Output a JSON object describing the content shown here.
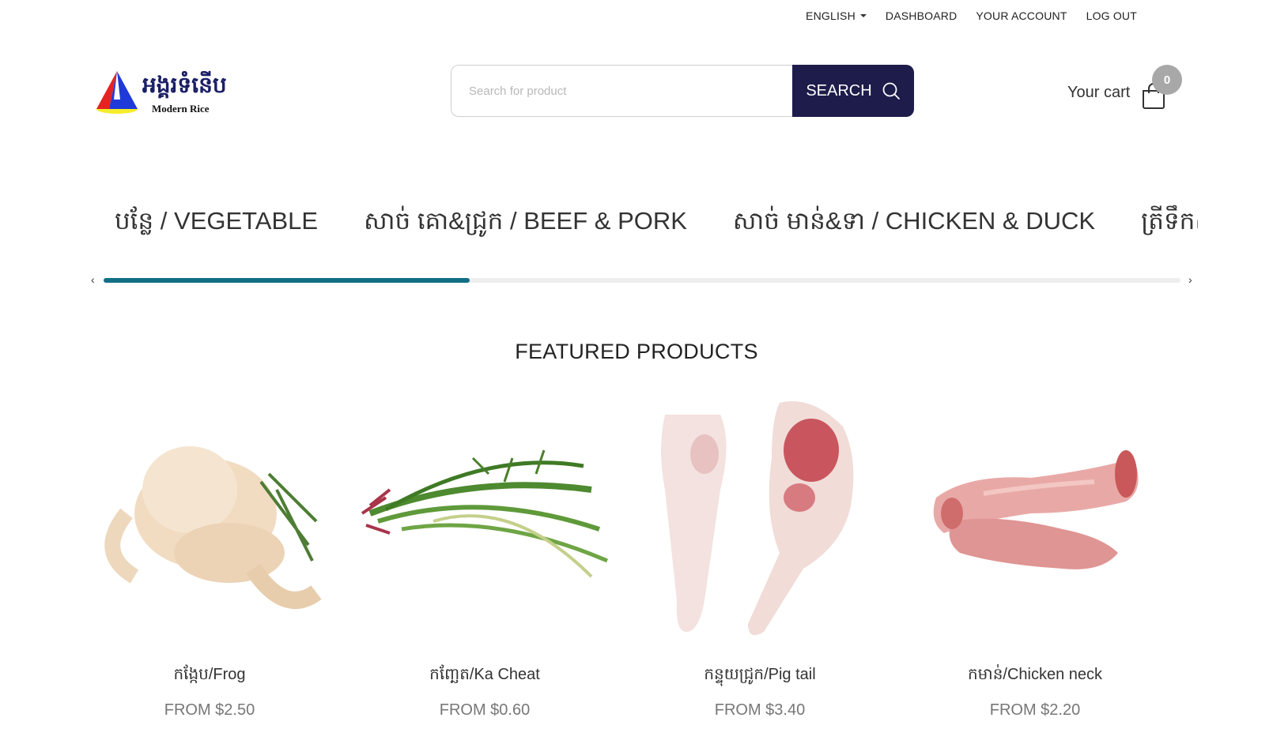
{
  "nav": {
    "language": "ENGLISH",
    "dashboard": "DASHBOARD",
    "account": "YOUR ACCOUNT",
    "logout": "LOG OUT"
  },
  "logo": {
    "khmer": "អង្គរទំនើប",
    "english": "Modern Rice"
  },
  "search": {
    "placeholder": "Search for product",
    "button": "SEARCH",
    "icon": "search-icon"
  },
  "cart": {
    "label": "Your cart",
    "count": "0",
    "icon": "shopping-bag-icon"
  },
  "categories": [
    "បន្លែ / VEGETABLE",
    "សាច់ គោ&ជ្រូក / BEEF & PORK",
    "សាច់ មាន់&ទា / CHICKEN & DUCK",
    "ត្រីទឹកសាប"
  ],
  "category_scroll_progress": 0.34,
  "featured": {
    "title": "FEATURED PRODUCTS",
    "products": [
      {
        "name": "កង្កែប/Frog",
        "price": "FROM $2.50"
      },
      {
        "name": "កញ្ឆែត/Ka Cheat",
        "price": "FROM $0.60"
      },
      {
        "name": "កន្ទុយជ្រូក/Pig tail",
        "price": "FROM $3.40"
      },
      {
        "name": "កមាន់/Chicken neck",
        "price": "FROM $2.20"
      }
    ]
  },
  "colors": {
    "brand": "#1d1c4a",
    "scroll": "#126f85",
    "badge": "#a8a8a8"
  }
}
